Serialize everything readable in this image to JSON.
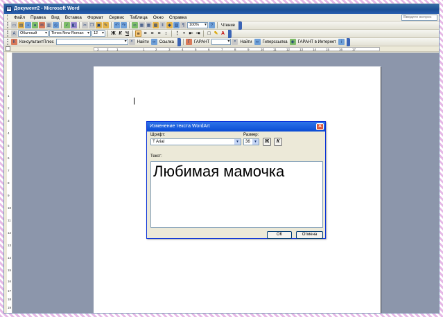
{
  "window": {
    "title": "Документ2 - Microsoft Word"
  },
  "menu": {
    "items": [
      "Файл",
      "Правка",
      "Вид",
      "Вставка",
      "Формат",
      "Сервис",
      "Таблица",
      "Окно",
      "Справка"
    ],
    "help_placeholder": "Введите вопрос"
  },
  "toolbar1": {
    "zoom": "100%",
    "reading": "Чтение"
  },
  "toolbar2": {
    "style": "Обычный",
    "font": "Times New Roman",
    "size": "12",
    "bold": "Ж",
    "italic": "К",
    "underline": "Ч"
  },
  "toolbar3": {
    "consultant": "КонсультантПлюс",
    "find": "Найти",
    "link": "Ссылка",
    "garant": "ГАРАНТ",
    "find2": "Найти",
    "hyperlink": "Гиперссылка",
    "garant_internet": "ГАРАНТ в Интернет"
  },
  "ruler": {
    "h_ticks": [
      "3",
      "2",
      "1",
      "1",
      "2",
      "3",
      "4",
      "5",
      "6",
      "7",
      "8",
      "9",
      "10",
      "11",
      "12",
      "13",
      "14",
      "15",
      "16",
      "17"
    ],
    "v_ticks": [
      "1",
      "2",
      "3",
      "4",
      "5",
      "6",
      "7",
      "8",
      "9",
      "10",
      "11",
      "12",
      "13",
      "14",
      "15",
      "16",
      "17",
      "18",
      "19"
    ]
  },
  "dialog": {
    "title": "Изменение текста WordArt",
    "font_label": "Шрифт:",
    "font_value": "Arial",
    "size_label": "Размер:",
    "size_value": "36",
    "bold": "Ж",
    "italic": "К",
    "text_label": "Текст:",
    "text_value": "Любимая мамочка",
    "ok": "ОК",
    "cancel": "Отмена"
  }
}
